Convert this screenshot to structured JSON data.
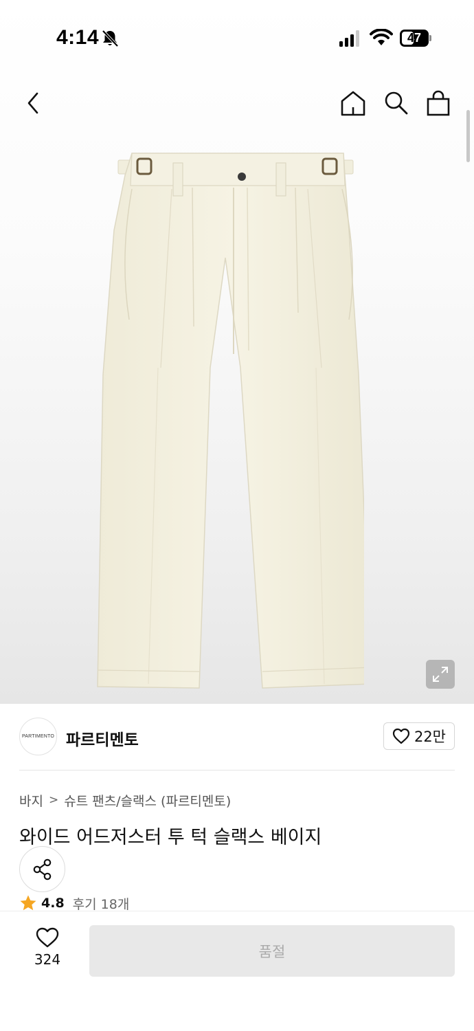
{
  "status_bar": {
    "time": "4:14",
    "battery_level": "47",
    "battery_fraction": 0.47,
    "icons": [
      "bell-off-icon",
      "signal-icon",
      "wifi-icon",
      "battery-icon"
    ]
  },
  "top_nav": {
    "icons": [
      "chevron-left-icon",
      "home-icon",
      "search-icon",
      "shopping-bag-icon"
    ]
  },
  "brand": {
    "logo_text": "PARTIMENTO",
    "name": "파르티멘토",
    "like_count": "22만"
  },
  "breadcrumb": {
    "items": [
      "바지",
      "슈트 팬츠/슬랙스 (파르티멘토)"
    ],
    "separator": ">"
  },
  "product": {
    "title": "와이드 어드저스터 투 턱 슬랙스 베이지",
    "rating": "4.8",
    "review_label": "후기 18개"
  },
  "bottom_bar": {
    "wish_count": "324",
    "soldout_label": "품절"
  },
  "colors": {
    "star": "#F5A623",
    "pants": "#F3F0DF",
    "soldout_bg": "#E8E8E8"
  }
}
